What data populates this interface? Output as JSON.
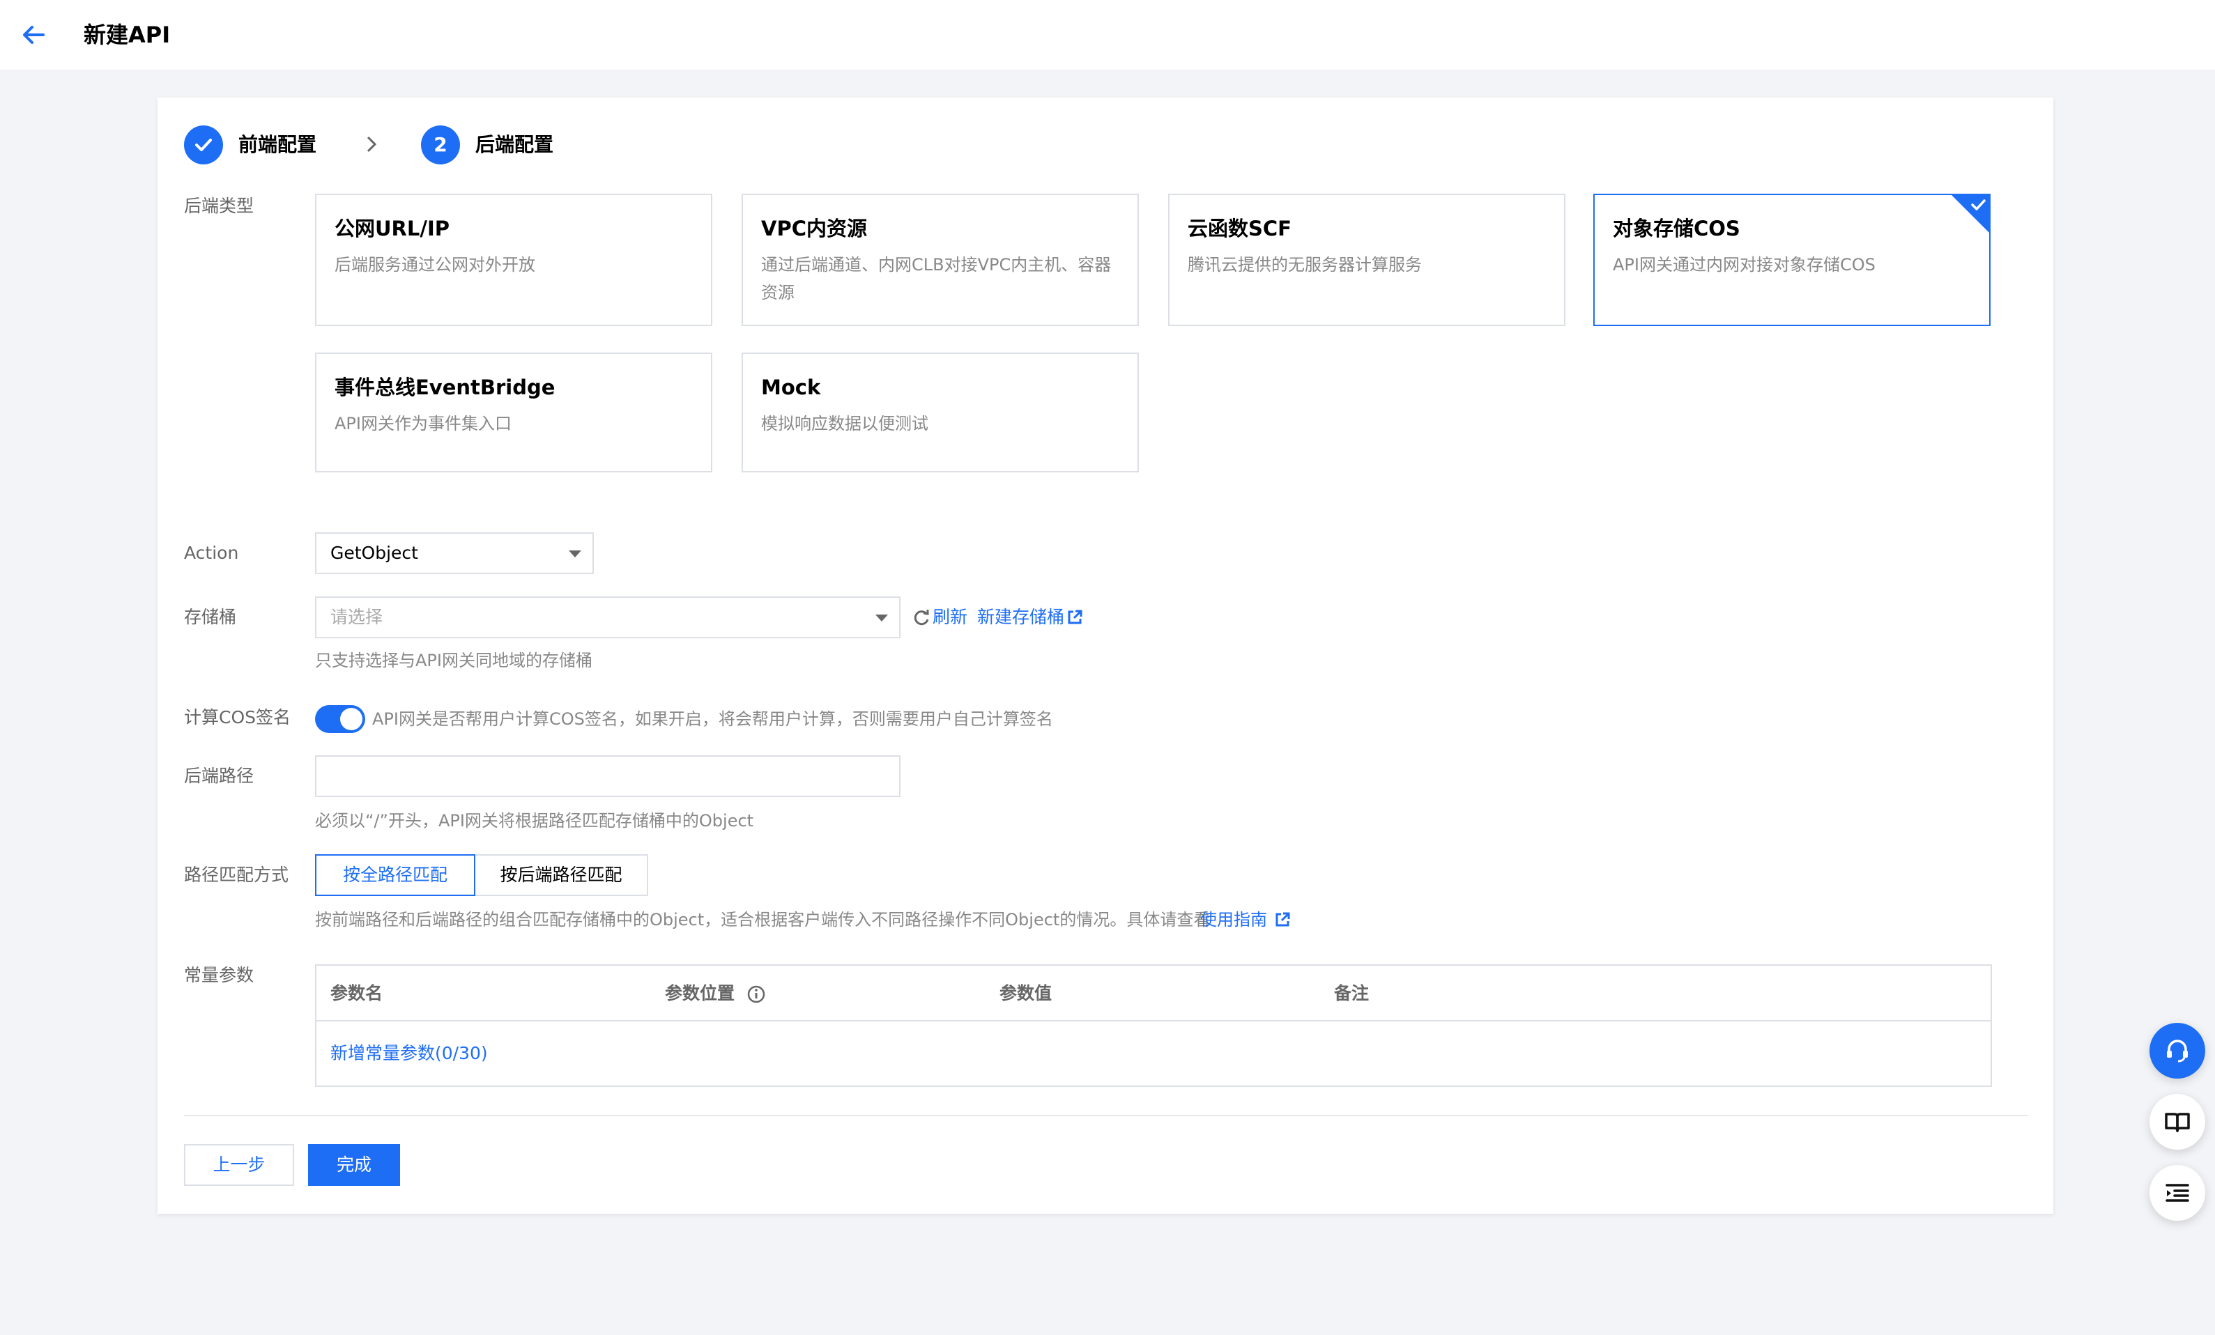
{
  "header": {
    "title": "新建API"
  },
  "steps": [
    {
      "label": "前端配置",
      "status": "done"
    },
    {
      "label": "后端配置",
      "number": "2",
      "status": "active"
    }
  ],
  "backend_type": {
    "label": "后端类型",
    "options": [
      {
        "title": "公网URL/IP",
        "desc": "后端服务通过公网对外开放"
      },
      {
        "title": "VPC内资源",
        "desc": "通过后端通道、内网CLB对接VPC内主机、容器资源"
      },
      {
        "title": "云函数SCF",
        "desc": "腾讯云提供的无服务器计算服务"
      },
      {
        "title": "对象存储COS",
        "desc": "API网关通过内网对接对象存储COS",
        "selected": true
      },
      {
        "title": "事件总线EventBridge",
        "desc": "API网关作为事件集入口"
      },
      {
        "title": "Mock",
        "desc": "模拟响应数据以便测试"
      }
    ]
  },
  "action": {
    "label": "Action",
    "value": "GetObject"
  },
  "bucket": {
    "label": "存储桶",
    "placeholder": "请选择",
    "refresh": "刷新",
    "create": "新建存储桶",
    "hint": "只支持选择与API网关同地域的存储桶"
  },
  "cos_sign": {
    "label": "计算COS签名",
    "enabled": true,
    "desc": "API网关是否帮用户计算COS签名，如果开启，将会帮用户计算，否则需要用户自己计算签名"
  },
  "backend_path": {
    "label": "后端路径",
    "value": "",
    "hint": "必须以“/”开头，API网关将根据路径匹配存储桶中的Object"
  },
  "path_match": {
    "label": "路径匹配方式",
    "options": [
      "按全路径匹配",
      "按后端路径匹配"
    ],
    "selected": "按全路径匹配",
    "hint": "按前端路径和后端路径的组合匹配存储桶中的Object，适合根据客户端传入不同路径操作不同Object的情况。具体请查看",
    "guide_link": "使用指南"
  },
  "const_params": {
    "label": "常量参数",
    "columns": [
      "参数名",
      "参数位置",
      "参数值",
      "备注"
    ],
    "add_link": "新增常量参数(0/30)"
  },
  "footer": {
    "prev": "上一步",
    "done": "完成"
  },
  "colors": {
    "accent": "#1e6ef5",
    "bg": "#f3f4f7"
  },
  "floating": [
    "headset-icon",
    "book-icon",
    "list-icon"
  ]
}
